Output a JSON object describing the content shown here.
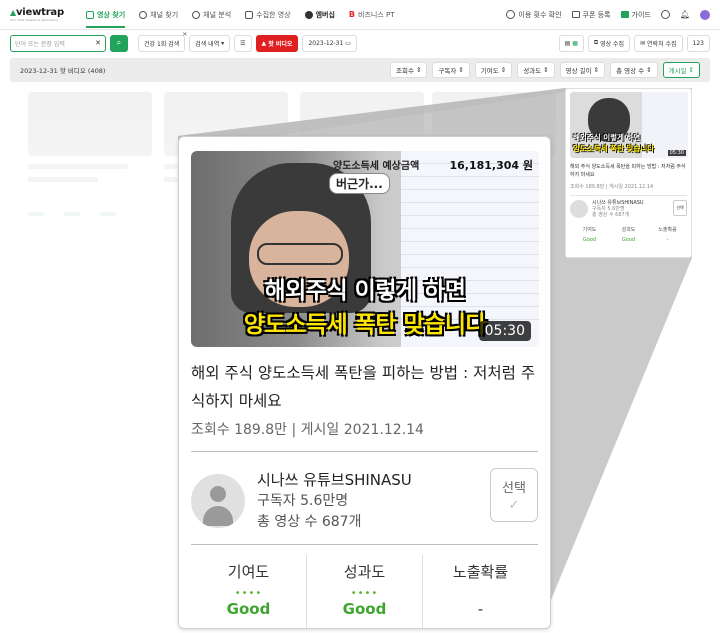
{
  "nav": {
    "logo": "viewtrap",
    "logo_tagline": "Your Total Viewers & Application",
    "items": [
      {
        "label": "영상 찾기",
        "active": true
      },
      {
        "label": "채널 찾기"
      },
      {
        "label": "채널 분석"
      },
      {
        "label": "수집한 영상"
      },
      {
        "label": "엠버십"
      },
      {
        "label": "비즈니스 PT"
      }
    ],
    "right": {
      "usage": "이용 횟수 확인",
      "coupon": "쿠폰 등록",
      "guide": "가이드"
    }
  },
  "toolbar": {
    "search_placeholder": "단어 또는 문장 입력",
    "filter_recent": "건강 1회 검색",
    "search_history": "검색 내역",
    "hot_video": "핫 비디오",
    "date": "2023-12-31",
    "collect_video": "영상 수집",
    "collect_contact": "연락처 수집",
    "count": "123"
  },
  "filterbar": {
    "summary": "2023-12-31 핫 비디오 (408)",
    "sorts": [
      "조회수",
      "구독자",
      "기여도",
      "성과도",
      "영상 길이",
      "총 영상 수",
      "게시일"
    ],
    "active_sort": "게시일"
  },
  "small_card": {
    "title": "해외 주식 양도소득세 폭탄을 피하는 방법 : 저처럼 주식하지 마세요",
    "meta": "조회수 189.8만 | 게시일 2021.12.14",
    "channel": "시나쓰 유튜브SHINASU",
    "subs": "구독자 5.6만명",
    "total": "총 영상 수 687개",
    "select": "선택",
    "stats": [
      "기여도",
      "성과도",
      "노출확률"
    ],
    "values": [
      "Good",
      "Good",
      "-"
    ],
    "duration": "05:30"
  },
  "card": {
    "thumb": {
      "label": "양도소득세 예상금액",
      "amount": "16,181,304 원",
      "bubble": "버근가...",
      "caption1": "해외주식 이렇게 하면",
      "caption2": "양도소득세 폭탄 맞습니다",
      "duration": "05:30"
    },
    "title": "해외 주식 양도소득세 폭탄을 피하는 방법 : 저처럼 주식하지 마세요",
    "meta": "조회수 189.8만 | 게시일 2021.12.14",
    "channel": {
      "name": "시나쓰 유튜브SHINASU",
      "subscribers": "구독자 5.6만명",
      "total_videos": "총 영상 수 687개"
    },
    "select_label": "선택",
    "stats": [
      {
        "label": "기여도",
        "value": "Good"
      },
      {
        "label": "성과도",
        "value": "Good"
      },
      {
        "label": "노출확률",
        "value": "-"
      }
    ]
  },
  "colors": {
    "accent": "#21a35b",
    "hot": "#e02020",
    "good": "#3ea52e"
  }
}
